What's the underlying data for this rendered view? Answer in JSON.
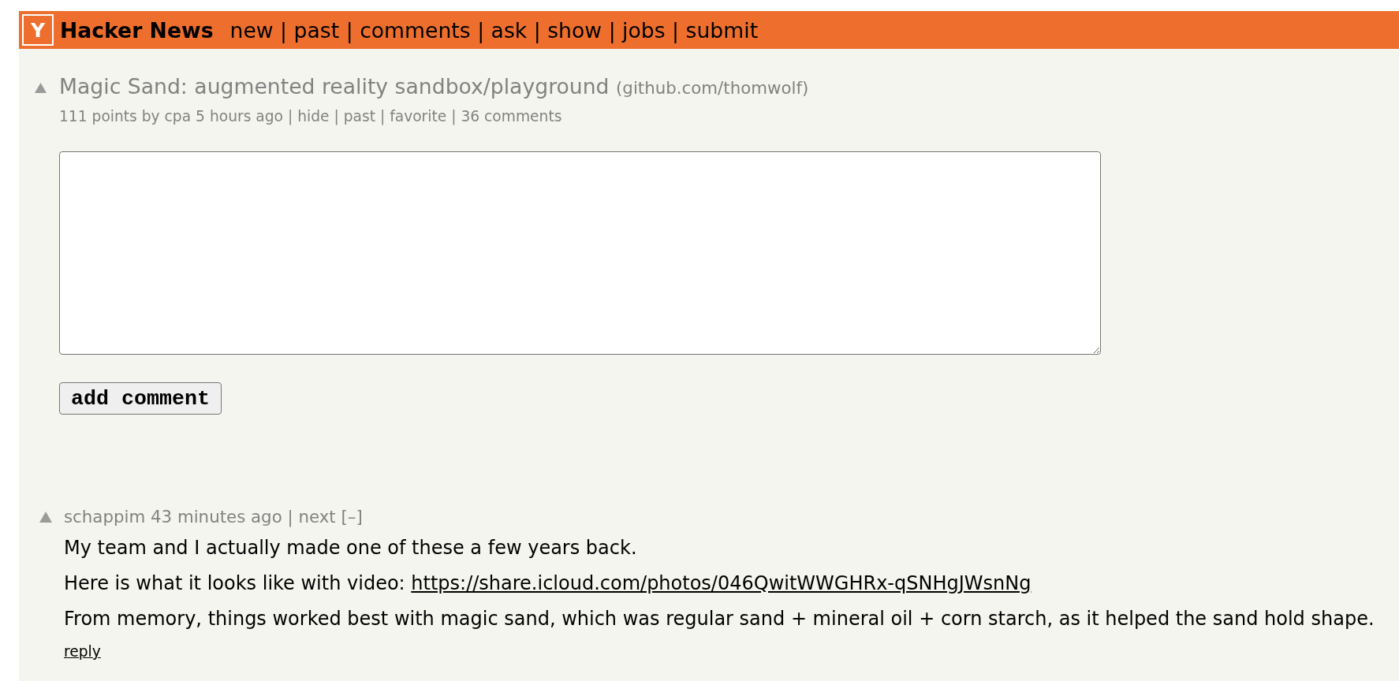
{
  "header": {
    "logo": "Y",
    "site_name": "Hacker News",
    "separator": "|",
    "nav": [
      "new",
      "past",
      "comments",
      "ask",
      "show",
      "jobs",
      "submit"
    ]
  },
  "story": {
    "title": "Magic Sand: augmented reality sandbox/playground",
    "site": "(github.com/thomwolf)",
    "score": "111 points",
    "by": "by",
    "user": "cpa",
    "age": "5 hours ago",
    "links": [
      "hide",
      "past",
      "favorite",
      "36 comments"
    ]
  },
  "comment_form": {
    "button": "add comment"
  },
  "comments": [
    {
      "user": "schappim",
      "age": "43 minutes ago",
      "links": [
        "next"
      ],
      "toggle": "[–]",
      "paragraphs": [
        {
          "text": "My team and I actually made one of these a few years back."
        },
        {
          "text": "Here is what it looks like with video:",
          "link": "https://share.icloud.com/photos/046QwitWWGHRx-qSNHgJWsnNg"
        },
        {
          "text": "From memory, things worked best with magic sand, which was regular sand + mineral oil + corn starch, as it helped the sand hold shape."
        }
      ],
      "reply": "reply"
    }
  ]
}
